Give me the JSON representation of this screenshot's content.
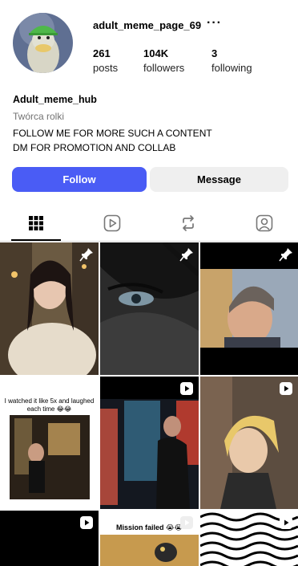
{
  "profile": {
    "username": "adult_meme_page_69",
    "more_glyph": "···",
    "avatar_icon": "duck-avatar-icon",
    "display_name": "Adult_meme_hub",
    "category": "Twórca rolki",
    "bio_lines": [
      "FOLLOW ME FOR MORE SUCH A CONTENT",
      "DM FOR PROMOTION AND COLLAB"
    ]
  },
  "stats": [
    {
      "num": "261",
      "label": "posts"
    },
    {
      "num": "104K",
      "label": "followers"
    },
    {
      "num": "3",
      "label": "following"
    }
  ],
  "actions": {
    "follow_label": "Follow",
    "message_label": "Message",
    "follow_color": "#4a5cf5",
    "message_color": "#efefef"
  },
  "tabs": [
    {
      "icon": "grid-icon",
      "active": true
    },
    {
      "icon": "reels-icon",
      "active": false
    },
    {
      "icon": "reposts-icon",
      "active": false
    },
    {
      "icon": "tagged-icon",
      "active": false
    }
  ],
  "posts": [
    {
      "badge": "pin-icon",
      "caption": ""
    },
    {
      "badge": "pin-icon",
      "caption": ""
    },
    {
      "badge": "pin-icon",
      "caption": ""
    },
    {
      "badge": "",
      "caption": "I watched it like 5x and laughed each time 😂😂"
    },
    {
      "badge": "reel-icon",
      "caption": ""
    },
    {
      "badge": "reel-icon",
      "caption": ""
    },
    {
      "badge": "reel-icon",
      "caption": ""
    },
    {
      "badge": "reel-icon",
      "caption": "Mission failed 😭😭"
    },
    {
      "badge": "reel-icon",
      "caption": ""
    }
  ]
}
